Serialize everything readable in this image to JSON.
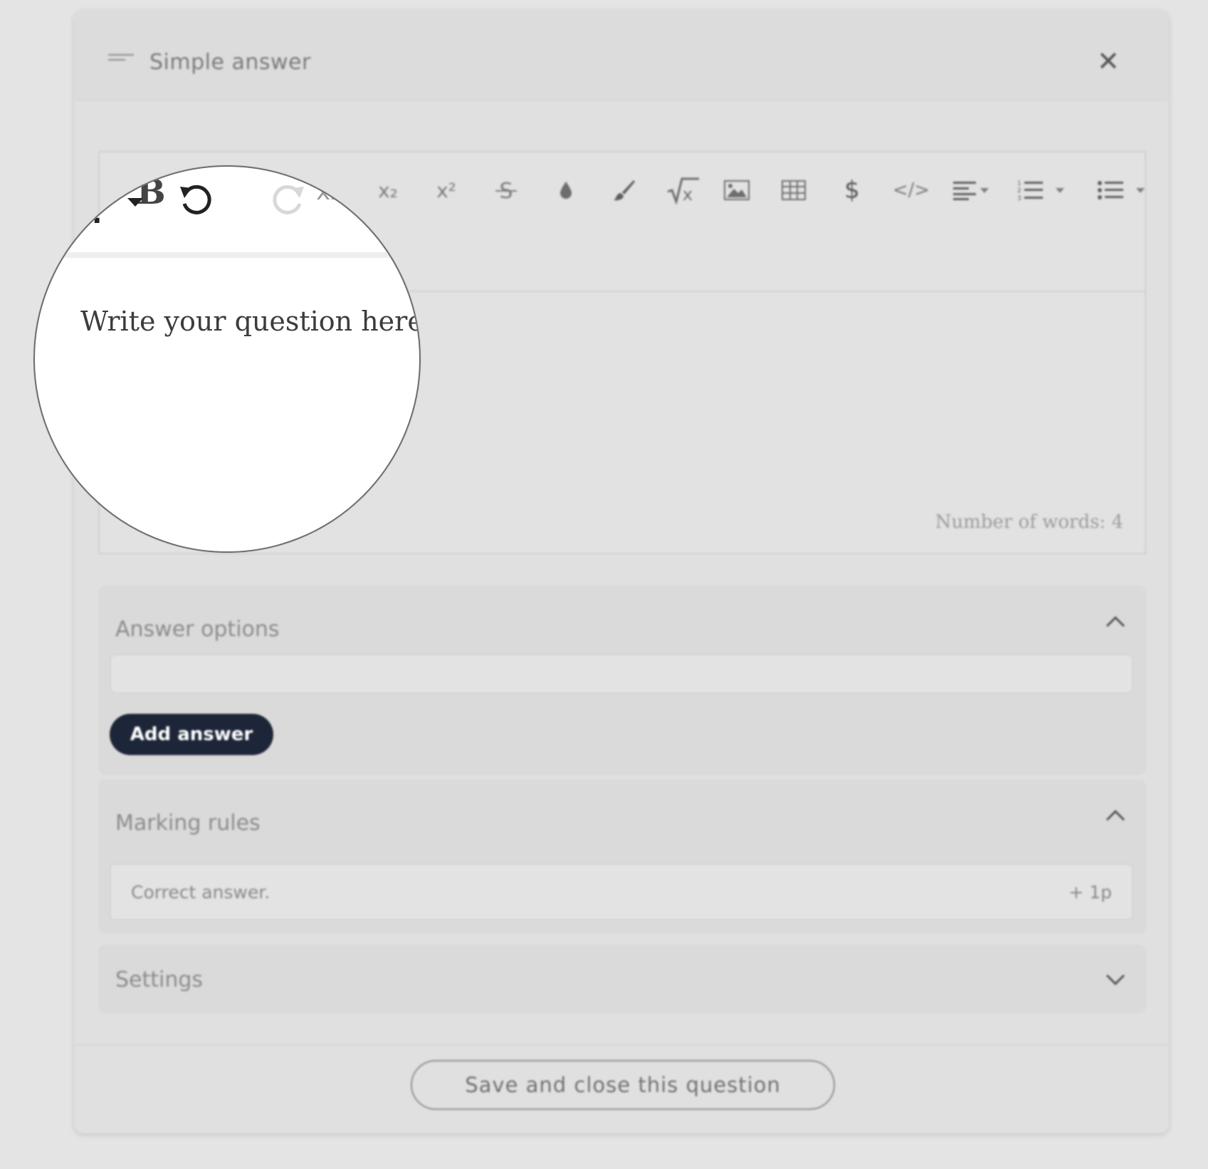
{
  "header": {
    "title": "Simple answer",
    "menu_icon": "drag-lines-icon",
    "close_icon": "close-icon"
  },
  "toolbar": {
    "items": [
      "bold-icon",
      "font-select",
      "undo-icon",
      "redo-icon",
      "subscript-icon",
      "superscript-icon",
      "strikethrough-icon",
      "text-color-icon",
      "highlight-brush-icon",
      "math-sqrt-icon",
      "image-icon",
      "table-icon",
      "dollar-icon",
      "code-icon",
      "align-dropdown",
      "ordered-list-dropdown",
      "bullet-list-dropdown"
    ],
    "bold_label": "B",
    "subscript_label": "x₂",
    "superscript_label": "x²",
    "dollar_label": "$",
    "code_label": "</>"
  },
  "editor": {
    "placeholder": "Write your question here...",
    "word_count": "Number of words: 4"
  },
  "answer_options": {
    "title": "Answer options",
    "add_button": "Add answer",
    "expanded": true
  },
  "marking_rules": {
    "title": "Marking rules",
    "expanded": true,
    "rules": [
      {
        "label": "Correct answer.",
        "points": "+ 1p"
      }
    ]
  },
  "settings": {
    "title": "Settings",
    "expanded": false
  },
  "footer": {
    "save_button": "Save and close this question"
  },
  "colors": {
    "add_button_bg": "#1d2638",
    "background": "#e4e4e4",
    "card": "#e0e0e0"
  }
}
